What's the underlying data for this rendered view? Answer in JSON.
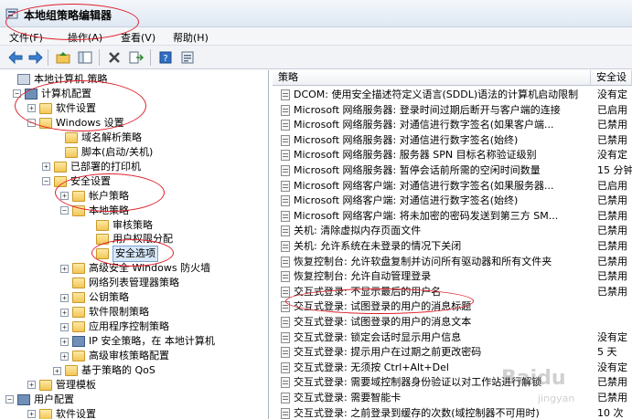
{
  "window": {
    "title": "本地组策略编辑器"
  },
  "menu": [
    {
      "label": "文件(F)"
    },
    {
      "label": "操作(A)"
    },
    {
      "label": "查看(V)"
    },
    {
      "label": "帮助(H)"
    }
  ],
  "tree": [
    {
      "label": "本地计算机 策略",
      "expander": "",
      "icon": "pc-root"
    },
    {
      "label": "计算机配置",
      "expander": "−",
      "icon": "computer"
    },
    {
      "label": "软件设置",
      "expander": "+",
      "icon": "folder"
    },
    {
      "label": "Windows 设置",
      "expander": "−",
      "icon": "folder"
    },
    {
      "label": "域名解析策略",
      "expander": "",
      "icon": "folder"
    },
    {
      "label": "脚本(启动/关机)",
      "expander": "",
      "icon": "folder"
    },
    {
      "label": "已部署的打印机",
      "expander": "+",
      "icon": "folder"
    },
    {
      "label": "安全设置",
      "expander": "−",
      "icon": "folder"
    },
    {
      "label": "帐户策略",
      "expander": "+",
      "icon": "folder"
    },
    {
      "label": "本地策略",
      "expander": "−",
      "icon": "folder"
    },
    {
      "label": "审核策略",
      "expander": "",
      "icon": "folder"
    },
    {
      "label": "用户权限分配",
      "expander": "",
      "icon": "folder"
    },
    {
      "label": "安全选项",
      "expander": "",
      "icon": "folder",
      "selected": true
    },
    {
      "label": "高级安全 Windows 防火墙",
      "expander": "+",
      "icon": "folder"
    },
    {
      "label": "网络列表管理器策略",
      "expander": "",
      "icon": "folder"
    },
    {
      "label": "公钥策略",
      "expander": "+",
      "icon": "folder"
    },
    {
      "label": "软件限制策略",
      "expander": "+",
      "icon": "folder"
    },
    {
      "label": "应用程序控制策略",
      "expander": "+",
      "icon": "folder"
    },
    {
      "label": "IP 安全策略，在 本地计算机",
      "expander": "+",
      "icon": "computer"
    },
    {
      "label": "高级审核策略配置",
      "expander": "+",
      "icon": "folder"
    },
    {
      "label": "基于策略的 QoS",
      "expander": "+",
      "icon": "folder"
    },
    {
      "label": "管理模板",
      "expander": "+",
      "icon": "folder"
    },
    {
      "label": "用户配置",
      "expander": "−",
      "icon": "computer"
    },
    {
      "label": "软件设置",
      "expander": "+",
      "icon": "folder"
    }
  ],
  "columns": {
    "policy": "策略",
    "setting": "安全设"
  },
  "policies": [
    {
      "name": "DCOM: 使用安全描述符定义语言(SDDL)语法的计算机启动限制",
      "value": "没有定"
    },
    {
      "name": "Microsoft 网络服务器: 登录时间过期后断开与客户端的连接",
      "value": "已启用"
    },
    {
      "name": "Microsoft 网络服务器: 对通信进行数字签名(如果客户端...",
      "value": "已禁用"
    },
    {
      "name": "Microsoft 网络服务器: 对通信进行数字签名(始终)",
      "value": "已禁用"
    },
    {
      "name": "Microsoft 网络服务器: 服务器 SPN 目标名称验证级别",
      "value": "没有定"
    },
    {
      "name": "Microsoft 网络服务器: 暂停会话前所需的空闲时间数量",
      "value": "15 分钟"
    },
    {
      "name": "Microsoft 网络客户端: 对通信进行数字签名(如果服务器...",
      "value": "已启用"
    },
    {
      "name": "Microsoft 网络客户端: 对通信进行数字签名(始终)",
      "value": "已禁用"
    },
    {
      "name": "Microsoft 网络客户端: 将未加密的密码发送到第三方 SM...",
      "value": "已禁用"
    },
    {
      "name": "关机: 清除虚拟内存页面文件",
      "value": "已禁用"
    },
    {
      "name": "关机: 允许系统在未登录的情况下关闭",
      "value": "已禁用"
    },
    {
      "name": "恢复控制台: 允许软盘复制并访问所有驱动器和所有文件夹",
      "value": "已禁用"
    },
    {
      "name": "恢复控制台: 允许自动管理登录",
      "value": "已禁用"
    },
    {
      "name": "交互式登录: 不显示最后的用户名",
      "value": "已禁用"
    },
    {
      "name": "交互式登录: 试图登录的用户的消息标题",
      "value": ""
    },
    {
      "name": "交互式登录: 试图登录的用户的消息文本",
      "value": ""
    },
    {
      "name": "交互式登录: 锁定会话时显示用户信息",
      "value": "没有定"
    },
    {
      "name": "交互式登录: 提示用户在过期之前更改密码",
      "value": "5 天"
    },
    {
      "name": "交互式登录: 无须按 Ctrl+Alt+Del",
      "value": "没有定"
    },
    {
      "name": "交互式登录: 需要域控制器身份验证以对工作站进行解锁",
      "value": "已禁用"
    },
    {
      "name": "交互式登录: 需要智能卡",
      "value": "已禁用"
    },
    {
      "name": "交互式登录: 之前登录到缓存的次数(域控制器不可用时)",
      "value": "10 次"
    }
  ],
  "watermark": {
    "text": "Baidu",
    "sub": "jingyan"
  }
}
